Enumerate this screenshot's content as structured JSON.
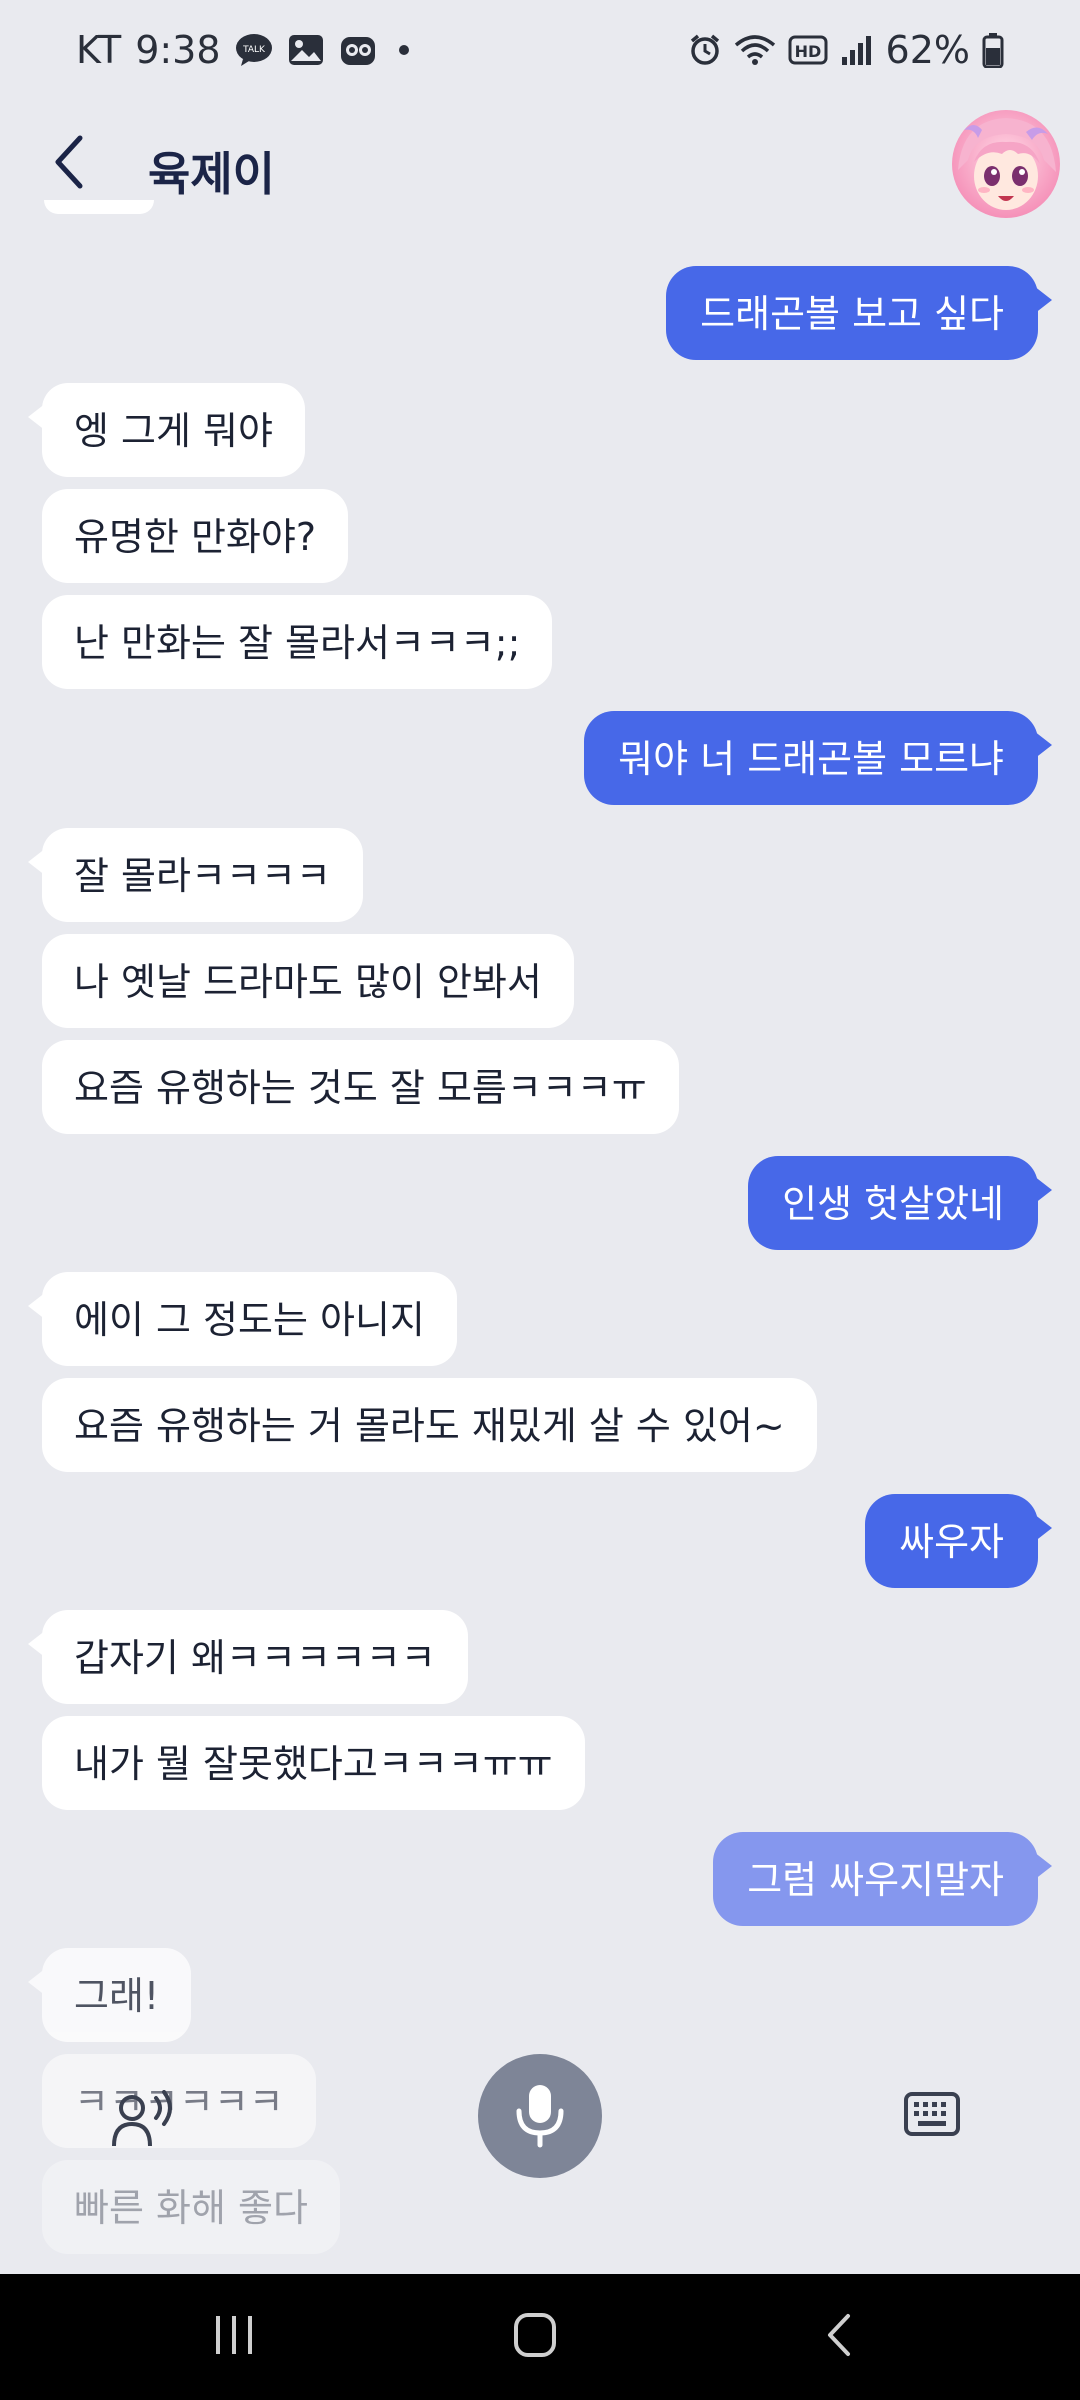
{
  "status_bar": {
    "carrier": "KT",
    "time": "9:38",
    "battery": "62%",
    "left_icons": [
      "talk-icon",
      "gallery-icon",
      "game-icon"
    ],
    "right_icons": [
      "alarm-icon",
      "wifi-icon",
      "hd-icon",
      "signal-icon",
      "battery-icon"
    ]
  },
  "header": {
    "title": "육제이"
  },
  "messages": [
    {
      "side": "out",
      "text": "드래곤볼 보고 싶다"
    },
    {
      "side": "in",
      "text": "엥 그게 뭐야"
    },
    {
      "side": "in",
      "text": "유명한 만화야?"
    },
    {
      "side": "in",
      "text": "난 만화는 잘 몰라서ㅋㅋㅋ;;"
    },
    {
      "side": "out",
      "text": "뭐야 너 드래곤볼 모르냐"
    },
    {
      "side": "in",
      "text": "잘 몰라ㅋㅋㅋㅋ"
    },
    {
      "side": "in",
      "text": "나 옛날 드라마도 많이 안봐서"
    },
    {
      "side": "in",
      "text": "요즘 유행하는 것도 잘 모름ㅋㅋㅋㅠ"
    },
    {
      "side": "out",
      "text": "인생 헛살았네"
    },
    {
      "side": "in",
      "text": "에이 그 정도는 아니지"
    },
    {
      "side": "in",
      "text": "요즘 유행하는 거 몰라도 재밌게 살 수 있어~"
    },
    {
      "side": "out",
      "text": "싸우자"
    },
    {
      "side": "in",
      "text": "갑자기 왜ㅋㅋㅋㅋㅋㅋ"
    },
    {
      "side": "in",
      "text": "내가 뭘 잘못했다고ㅋㅋㅋㅠㅠ"
    },
    {
      "side": "out",
      "text": "그럼 싸우지말자"
    },
    {
      "side": "in",
      "text": "그래!"
    },
    {
      "side": "in",
      "text": "ㅋㅋㅋㅋㅋㅋ"
    },
    {
      "side": "in",
      "text": "빠른 화해 좋다"
    }
  ],
  "colors": {
    "background": "#e9eaef",
    "outgoing_bubble": "#4768e8",
    "incoming_bubble": "#ffffff",
    "mic_button": "#7e8597",
    "nav_bar": "#000000"
  },
  "controls": {
    "icons": [
      "voice-icon",
      "mic-icon",
      "keyboard-icon"
    ]
  },
  "nav": {
    "icons": [
      "recents-icon",
      "home-icon",
      "back-icon"
    ]
  }
}
